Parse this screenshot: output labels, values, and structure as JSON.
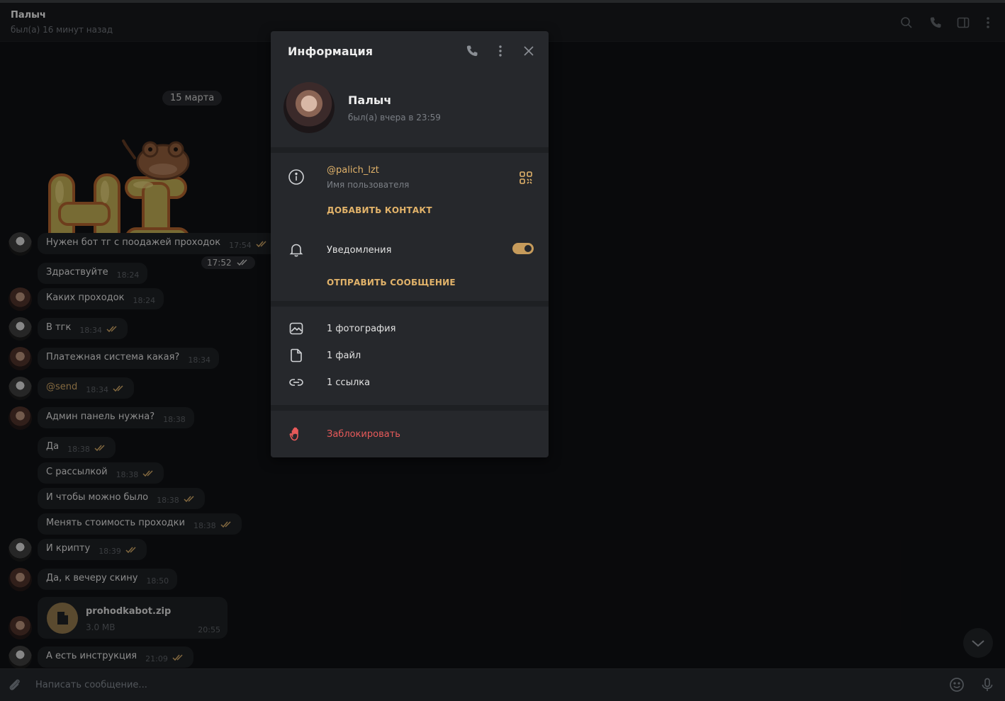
{
  "colors": {
    "accent": "#e2b36a",
    "danger": "#e85a5a",
    "tick_read": "#c8a061"
  },
  "header": {
    "name": "Палыч",
    "status": "был(а) 16 минут назад",
    "icons": [
      "search-icon",
      "phone-icon",
      "sidebar-toggle-icon",
      "more-vertical-icon"
    ]
  },
  "chat": {
    "date_divider": "15 марта",
    "sticker": {
      "text": "HI",
      "time": "17:52"
    },
    "messages": [
      {
        "text": "Нужен бот тг с поодажей проходок",
        "time": "17:54",
        "out": true
      },
      {
        "text": "Здраствуйте",
        "time": "18:24",
        "out": false
      },
      {
        "text": "Каких проходок",
        "time": "18:24",
        "out": false
      },
      {
        "text": "В тгк",
        "time": "18:34",
        "out": true
      },
      {
        "text": "Платежная система какая?",
        "time": "18:34",
        "out": false
      },
      {
        "text": "@send",
        "time": "18:34",
        "out": true
      },
      {
        "text": "Админ панель нужна?",
        "time": "18:38",
        "out": false
      },
      {
        "text": "Да",
        "time": "18:38",
        "out": true
      },
      {
        "text": "С рассылкой",
        "time": "18:38",
        "out": true
      },
      {
        "text": "И чтобы можно было",
        "time": "18:38",
        "out": true
      },
      {
        "text": "Менять стоимость проходки",
        "time": "18:38",
        "out": true
      },
      {
        "text": "И крипту",
        "time": "18:39",
        "out": true
      },
      {
        "text": "Да, к вечеру скину",
        "time": "18:50",
        "out": false
      }
    ],
    "file": {
      "name": "prohodkabot.zip",
      "size": "3.0 MB",
      "time": "20:55"
    },
    "last_message": {
      "text": "А есть инструкция",
      "time": "21:09"
    }
  },
  "composer": {
    "placeholder": "Написать сообщение..."
  },
  "info_panel": {
    "title": "Информация",
    "profile": {
      "name": "Палыч",
      "status": "был(а) вчера в 23:59"
    },
    "username": {
      "value": "@palich_lzt",
      "label": "Имя пользователя"
    },
    "add_contact": "ДОБАВИТЬ КОНТАКТ",
    "notifications": {
      "label": "Уведомления",
      "enabled": true
    },
    "send_message": "ОТПРАВИТЬ СООБЩЕНИЕ",
    "media": {
      "photos": "1 фотография",
      "files": "1 файл",
      "links": "1 ссылка"
    },
    "block": "Заблокировать"
  }
}
